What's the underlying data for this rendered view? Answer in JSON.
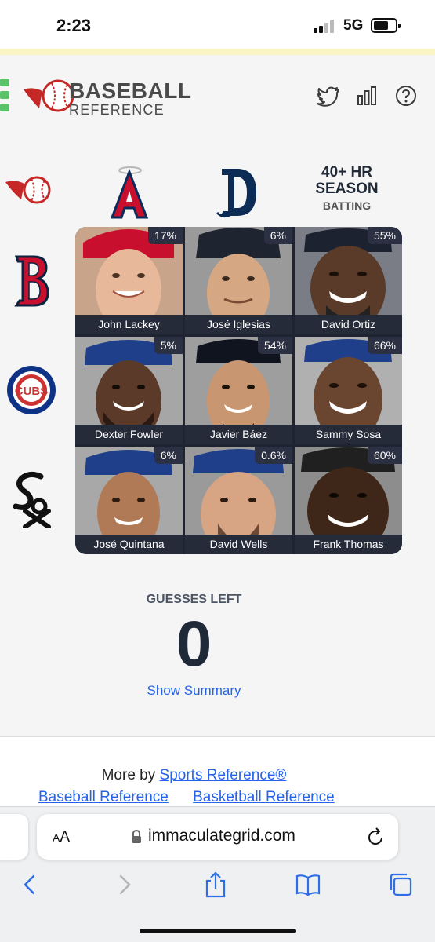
{
  "status_bar": {
    "time": "2:23",
    "network": "5G"
  },
  "header": {
    "logo_line1": "BASEBALL",
    "logo_line2": "REFERENCE",
    "icons": [
      "menu-icon",
      "twitter-icon",
      "stats-icon",
      "help-icon"
    ]
  },
  "columns": [
    {
      "team": "Angels",
      "icon": "angels-logo"
    },
    {
      "team": "Tigers",
      "icon": "tigers-logo"
    },
    {
      "stat_big": "40+ HR",
      "stat_big2": "SEASON",
      "stat_small": "BATTING"
    }
  ],
  "rows": [
    {
      "team": "Red Sox",
      "icon": "red-sox-logo"
    },
    {
      "team": "Cubs",
      "icon": "cubs-logo",
      "label": "CUBS"
    },
    {
      "team": "White Sox",
      "icon": "white-sox-logo"
    }
  ],
  "grid": [
    {
      "name": "John Lackey",
      "pct": "17%"
    },
    {
      "name": "José Iglesias",
      "pct": "6%"
    },
    {
      "name": "David Ortiz",
      "pct": "55%"
    },
    {
      "name": "Dexter Fowler",
      "pct": "5%"
    },
    {
      "name": "Javier Báez",
      "pct": "54%"
    },
    {
      "name": "Sammy Sosa",
      "pct": "66%"
    },
    {
      "name": "José Quintana",
      "pct": "6%"
    },
    {
      "name": "David Wells",
      "pct": "0.6%"
    },
    {
      "name": "Frank Thomas",
      "pct": "60%"
    }
  ],
  "guesses": {
    "label": "GUESSES LEFT",
    "count": "0",
    "summary_link": "Show Summary"
  },
  "footer": {
    "more_by": "More by ",
    "sports_ref": "Sports Reference®",
    "links": [
      "Baseball Reference",
      "Basketball Reference"
    ]
  },
  "browser": {
    "aa_big": "A",
    "aa_small": "A",
    "url": "immaculategrid.com"
  },
  "colors": {
    "grid_bg": "#1f2432",
    "link": "#2563eb",
    "accent_green": "#5cc26a"
  }
}
